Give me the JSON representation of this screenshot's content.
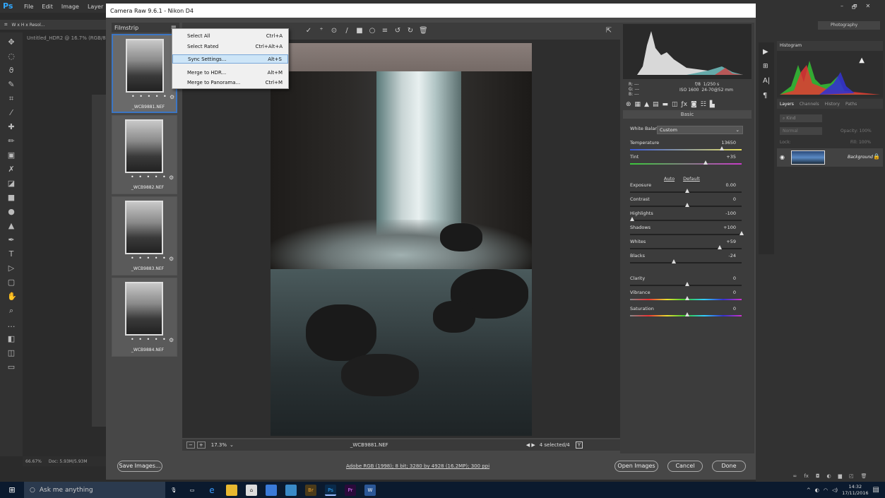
{
  "ps": {
    "logo": "Ps",
    "menu": [
      "File",
      "Edit",
      "Image",
      "Layer"
    ],
    "options_bar": [
      "W x H x Resol..."
    ],
    "doc_tab": "Untitled_HDR2 @ 16.7% (RGB/8)",
    "status_zoom": "66.67%",
    "status_doc": "Doc: 5.93M/5.93M",
    "workspace": "Photography",
    "win_controls": [
      "–",
      "🗗",
      "✕"
    ],
    "histogram_tab": "Histogram",
    "layers_tabs": [
      "Layers",
      "Channels",
      "History",
      "Paths"
    ],
    "layer_search": "Kind",
    "layer_blend": "Normal",
    "layer_opacity": "Opacity: 100%",
    "layer_lock": "Lock:",
    "layer_fill": "Fill: 100%",
    "layer_name": "Background"
  },
  "cr": {
    "title": "Camera Raw 9.6.1  -  Nikon D4",
    "filmstrip_label": "Filmstrip",
    "thumbs": [
      {
        "name": "_WCB9881.NEF",
        "stars": "• • • • •"
      },
      {
        "name": "_WCB9882.NEF",
        "stars": "• • • • •"
      },
      {
        "name": "_WCB9883.NEF",
        "stars": "• • • • •"
      },
      {
        "name": "_WCB9884.NEF",
        "stars": "• • • • •"
      }
    ],
    "menu": [
      {
        "label": "Select All",
        "shortcut": "Ctrl+A"
      },
      {
        "label": "Select Rated",
        "shortcut": "Ctrl+Alt+A"
      },
      {
        "label": "Sync Settings...",
        "shortcut": "Alt+S"
      },
      {
        "label": "Merge to HDR...",
        "shortcut": "Alt+M"
      },
      {
        "label": "Merge to Panorama...",
        "shortcut": "Ctrl+M"
      }
    ],
    "zoom": "17.3%",
    "filename": "_WCB9881.NEF",
    "selection": "4 selected/4",
    "workflow": "Adobe RGB (1998); 8 bit; 3280 by 4928 (16.2MP); 300 ppi",
    "buttons": {
      "save": "Save Images...",
      "open": "Open Images",
      "cancel": "Cancel",
      "done": "Done"
    },
    "readout": {
      "r": "R:",
      "g": "G:",
      "b": "B:",
      "dash": "---",
      "aperture": "f/8",
      "shutter": "1/250 s",
      "iso": "ISO 1600",
      "lens": "24-70@52 mm"
    },
    "panel_title": "Basic",
    "wb_label": "White Balance:",
    "wb_value": "Custom",
    "auto": "Auto",
    "default": "Default",
    "sliders": [
      {
        "label": "Temperature",
        "value": "13650",
        "pos": 0.82
      },
      {
        "label": "Tint",
        "value": "+35",
        "pos": 0.67
      },
      {
        "label": "Exposure",
        "value": "0.00",
        "pos": 0.5
      },
      {
        "label": "Contrast",
        "value": "0",
        "pos": 0.5
      },
      {
        "label": "Highlights",
        "value": "-100",
        "pos": 0.0
      },
      {
        "label": "Shadows",
        "value": "+100",
        "pos": 1.0
      },
      {
        "label": "Whites",
        "value": "+59",
        "pos": 0.8
      },
      {
        "label": "Blacks",
        "value": "-24",
        "pos": 0.38
      },
      {
        "label": "Clarity",
        "value": "0",
        "pos": 0.5
      },
      {
        "label": "Vibrance",
        "value": "0",
        "pos": 0.5
      },
      {
        "label": "Saturation",
        "value": "0",
        "pos": 0.5
      }
    ]
  },
  "taskbar": {
    "search": "Ask me anything",
    "time": "14:32",
    "date": "17/11/2016"
  }
}
